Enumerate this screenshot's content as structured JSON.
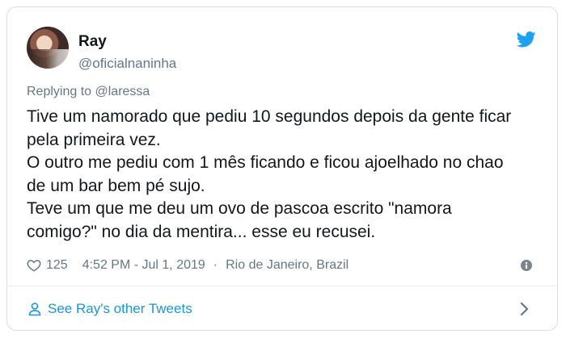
{
  "tweet": {
    "author_name": "Ray",
    "author_handle": "@oficialnaninha",
    "replying_prefix": "Replying to",
    "replying_to": "@laressa",
    "text_lines": [
      "Tive um namorado que pediu 10 segundos depois da gente ficar",
      "pela primeira vez.",
      "O outro me pediu com 1 mês ficando e ficou ajoelhado no chao",
      "de um bar bem pé sujo.",
      "Teve um que me deu um ovo de pascoa escrito \"namora",
      "comigo?\" no dia da mentira... esse eu recusei."
    ],
    "likes": "125",
    "time": "4:52 PM - Jul 1, 2019",
    "separator": "·",
    "location": "Rio de Janeiro, Brazil"
  },
  "footer": {
    "see_more_label": "See Ray's other Tweets"
  },
  "icons": {
    "twitter_bird": "twitter-bird-icon",
    "heart": "heart-icon",
    "info": "info-icon",
    "person": "person-icon",
    "chevron": "chevron-right-icon"
  },
  "colors": {
    "brand_blue": "#1da1f2",
    "link_blue": "#1b95e0",
    "secondary_text": "#657786",
    "border": "#d8dee2"
  }
}
